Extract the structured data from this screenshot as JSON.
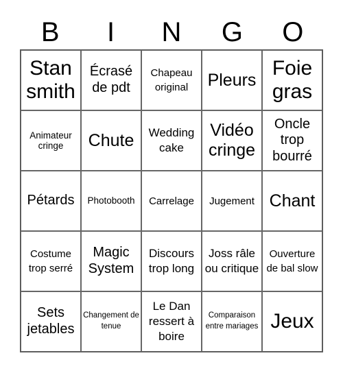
{
  "header": {
    "letters": [
      "B",
      "I",
      "N",
      "G",
      "O"
    ]
  },
  "grid": {
    "rows": [
      [
        {
          "text": "Stan smith"
        },
        {
          "text": "Écrasé de pdt"
        },
        {
          "text": "Chapeau original"
        },
        {
          "text": "Pleurs"
        },
        {
          "text": "Foie gras"
        }
      ],
      [
        {
          "text": "Animateur cringe"
        },
        {
          "text": "Chute"
        },
        {
          "text": "Wedding cake"
        },
        {
          "text": "Vidéo cringe"
        },
        {
          "text": "Oncle trop bourré"
        }
      ],
      [
        {
          "text": "Pétards"
        },
        {
          "text": "Photobooth"
        },
        {
          "text": "Carrelage"
        },
        {
          "text": "Jugement"
        },
        {
          "text": "Chant"
        }
      ],
      [
        {
          "text": "Costume trop serré"
        },
        {
          "text": "Magic System"
        },
        {
          "text": "Discours trop long"
        },
        {
          "text": "Joss râle ou critique"
        },
        {
          "text": "Ouverture de bal slow"
        }
      ],
      [
        {
          "text": "Sets jetables"
        },
        {
          "text": "Changement de tenue"
        },
        {
          "text": "Le Dan ressert à boire"
        },
        {
          "text": "Comparaison entre mariages"
        },
        {
          "text": "Jeux"
        }
      ]
    ]
  }
}
